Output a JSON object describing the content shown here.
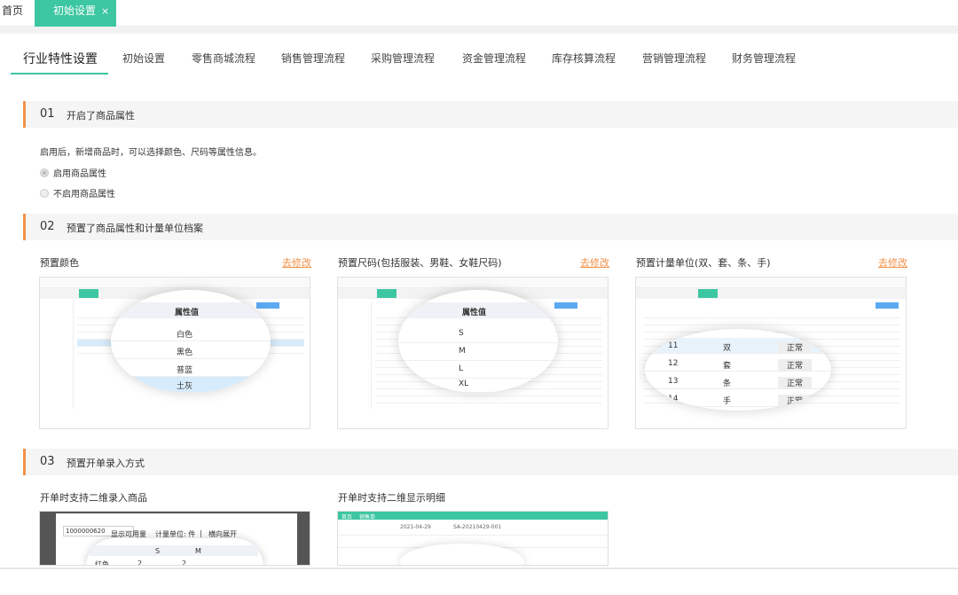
{
  "top_tabs": {
    "home": "首页",
    "active": "初始设置",
    "close": "×"
  },
  "nav_tabs": [
    "行业特性设置",
    "初始设置",
    "零售商城流程",
    "销售管理流程",
    "采购管理流程",
    "资金管理流程",
    "库存核算流程",
    "营销管理流程",
    "财务管理流程"
  ],
  "section1": {
    "num": "01",
    "title": "开启了商品属性",
    "desc": "启用后，新增商品时，可以选择颜色、尺码等属性信息。",
    "opt_enable": "启用商品属性",
    "opt_disable": "不启用商品属性"
  },
  "section2": {
    "num": "02",
    "title": "预置了商品属性和计量单位档案",
    "panels": [
      {
        "title": "预置颜色",
        "edit": "去修改",
        "mag_head": "属性值",
        "items": [
          "白色",
          "黑色",
          "普蓝",
          "土灰"
        ]
      },
      {
        "title": "预置尺码(包括服装、男鞋、女鞋尺码)",
        "edit": "去修改",
        "mag_head": "属性值",
        "items": [
          "S",
          "M",
          "L",
          "XL"
        ]
      },
      {
        "title": "预置计量单位(双、套、条、手)",
        "edit": "去修改",
        "items": [
          {
            "n": "11",
            "u": "双",
            "s": "正常"
          },
          {
            "n": "12",
            "u": "套",
            "s": "正常"
          },
          {
            "n": "13",
            "u": "条",
            "s": "正常"
          },
          {
            "n": "14",
            "u": "手",
            "s": "正常"
          }
        ]
      }
    ]
  },
  "section3": {
    "num": "03",
    "title": "预置开单录入方式",
    "panel1": "开单时支持二维录入商品",
    "panel2": "开单时支持二维显示明细",
    "shot1": {
      "code": "1000000620",
      "check": "显示可用量",
      "unit_label": "计量单位: 件",
      "sep": "|",
      "hor": "横向展开",
      "col_size1": "S",
      "col_size2": "M",
      "row_color": "红色",
      "v1": "2",
      "v2": "2"
    },
    "shot2": {
      "tab1": "首页",
      "tab2": "销售单",
      "date": "2021-04-29",
      "order": "SA-20210429-001"
    }
  },
  "colors": {
    "accent": "#3dc6a2",
    "orange": "#f0924a"
  }
}
